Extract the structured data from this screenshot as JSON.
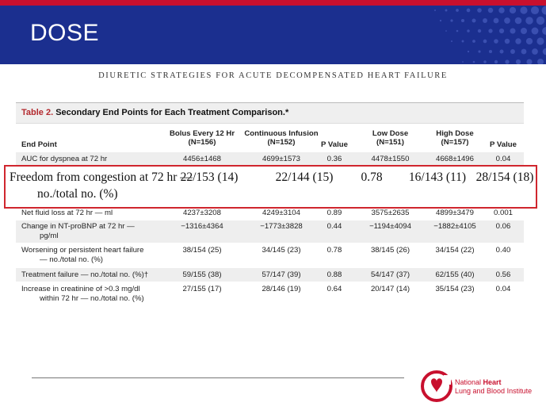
{
  "slide_title": "DOSE",
  "journal_header": "DIURETIC STRATEGIES FOR ACUTE DECOMPENSATED HEART FAILURE",
  "table": {
    "caption_num": "Table 2.",
    "caption_text": "Secondary End Points for Each Treatment Comparison.*",
    "headers": {
      "end_point": "End Point",
      "bolus_1": "Bolus Every 12 Hr",
      "bolus_2": "(N=156)",
      "cont_1": "Continuous Infusion",
      "cont_2": "(N=152)",
      "p1": "P Value",
      "low_1": "Low Dose",
      "low_2": "(N=151)",
      "high_1": "High Dose",
      "high_2": "(N=157)",
      "p2": "P Value"
    },
    "rows": [
      {
        "label1": "AUC for dyspnea at 72 hr",
        "label2": "",
        "bolus": "4456±1468",
        "cont": "4699±1573",
        "p1": "0.36",
        "low": "4478±1550",
        "high": "4668±1496",
        "p2": "0.04"
      },
      {
        "label1": "Net fluid loss at 72 hr — ml",
        "label2": "",
        "bolus": "4237±3208",
        "cont": "4249±3104",
        "p1": "0.89",
        "low": "3575±2635",
        "high": "4899±3479",
        "p2": "0.001"
      },
      {
        "label1": "Change in NT-proBNP at 72 hr —",
        "label2": "pg/ml",
        "bolus": "−1316±4364",
        "cont": "−1773±3828",
        "p1": "0.44",
        "low": "−1194±4094",
        "high": "−1882±4105",
        "p2": "0.06"
      },
      {
        "label1": "Worsening or persistent heart failure",
        "label2": "— no./total no. (%)",
        "bolus": "38/154 (25)",
        "cont": "34/145 (23)",
        "p1": "0.78",
        "low": "38/145 (26)",
        "high": "34/154 (22)",
        "p2": "0.40"
      },
      {
        "label1": "Treatment failure — no./total no. (%)†",
        "label2": "",
        "bolus": "59/155 (38)",
        "cont": "57/147 (39)",
        "p1": "0.88",
        "low": "54/147 (37)",
        "high": "62/155 (40)",
        "p2": "0.56"
      },
      {
        "label1": "Increase in creatinine of >0.3 mg/dl",
        "label2": "within 72 hr — no./total no. (%)",
        "bolus": "27/155 (17)",
        "cont": "28/146 (19)",
        "p1": "0.64",
        "low": "20/147 (14)",
        "high": "35/154 (23)",
        "p2": "0.04"
      }
    ]
  },
  "highlight": {
    "label1": "Freedom from congestion at 72 hr —",
    "label2": "no./total no. (%)",
    "bolus": "22/153 (14)",
    "cont": "22/144 (15)",
    "p1": "0.78",
    "low": "16/143 (11)",
    "high": "28/154 (18)"
  },
  "logo": {
    "line1": "National",
    "line1b": "Heart",
    "line2": "Lung and Blood",
    "line2b": "Institute"
  },
  "colors": {
    "header_blue": "#1b2f8f",
    "accent_red": "#c8102e",
    "highlight_border": "#d0262e"
  }
}
